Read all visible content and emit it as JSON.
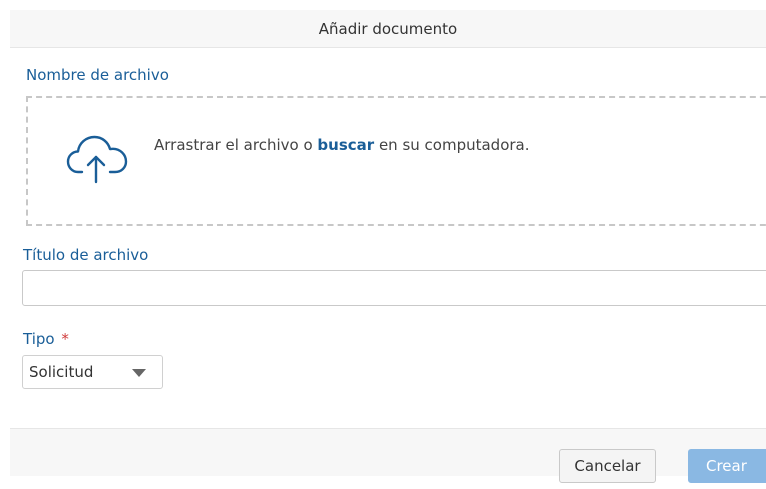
{
  "dialog": {
    "title": "Añadir documento"
  },
  "file_name": {
    "label": "Nombre de archivo",
    "dropzone": {
      "icon": "cloud-upload-icon",
      "text_before": "Arrastrar el archivo o ",
      "browse_link": "buscar",
      "text_after": " en su computadora."
    }
  },
  "file_title": {
    "label": "Título de archivo",
    "value": "",
    "placeholder": ""
  },
  "type": {
    "label": "Tipo",
    "required_marker": "*",
    "selected": "Solicitud",
    "icon": "chevron-down-icon"
  },
  "footer": {
    "cancel_label": "Cancelar",
    "create_label": "Crear"
  },
  "colors": {
    "label_blue": "#1a5e98",
    "required_red": "#d03c3c",
    "primary_button": "#8ab8e3"
  }
}
